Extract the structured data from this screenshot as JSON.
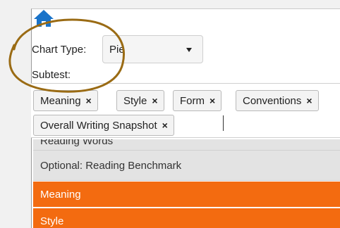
{
  "filters": {
    "chart_type_label": "Chart Type:",
    "chart_type_value": "Pie",
    "subtest_label": "Subtest:"
  },
  "selected_subtests": [
    {
      "label": "Meaning",
      "remove": "×"
    },
    {
      "label": "Style",
      "remove": "×"
    },
    {
      "label": "Form",
      "remove": "×"
    },
    {
      "label": "Conventions",
      "remove": "×"
    },
    {
      "label": "Overall Writing Snapshot",
      "remove": "×"
    }
  ],
  "options": [
    {
      "label": "Reading Words",
      "selected": false
    },
    {
      "label": "Optional: Reading Benchmark",
      "selected": false
    },
    {
      "label": "Meaning",
      "selected": true
    },
    {
      "label": "Style",
      "selected": true
    }
  ],
  "colors": {
    "accent": "#f36b10",
    "home_icon": "#1a73c9",
    "annotation": "#9a6b14"
  },
  "icons": {
    "home": "home-icon",
    "dropdown": "chevron-down-icon",
    "remove": "close-icon"
  }
}
